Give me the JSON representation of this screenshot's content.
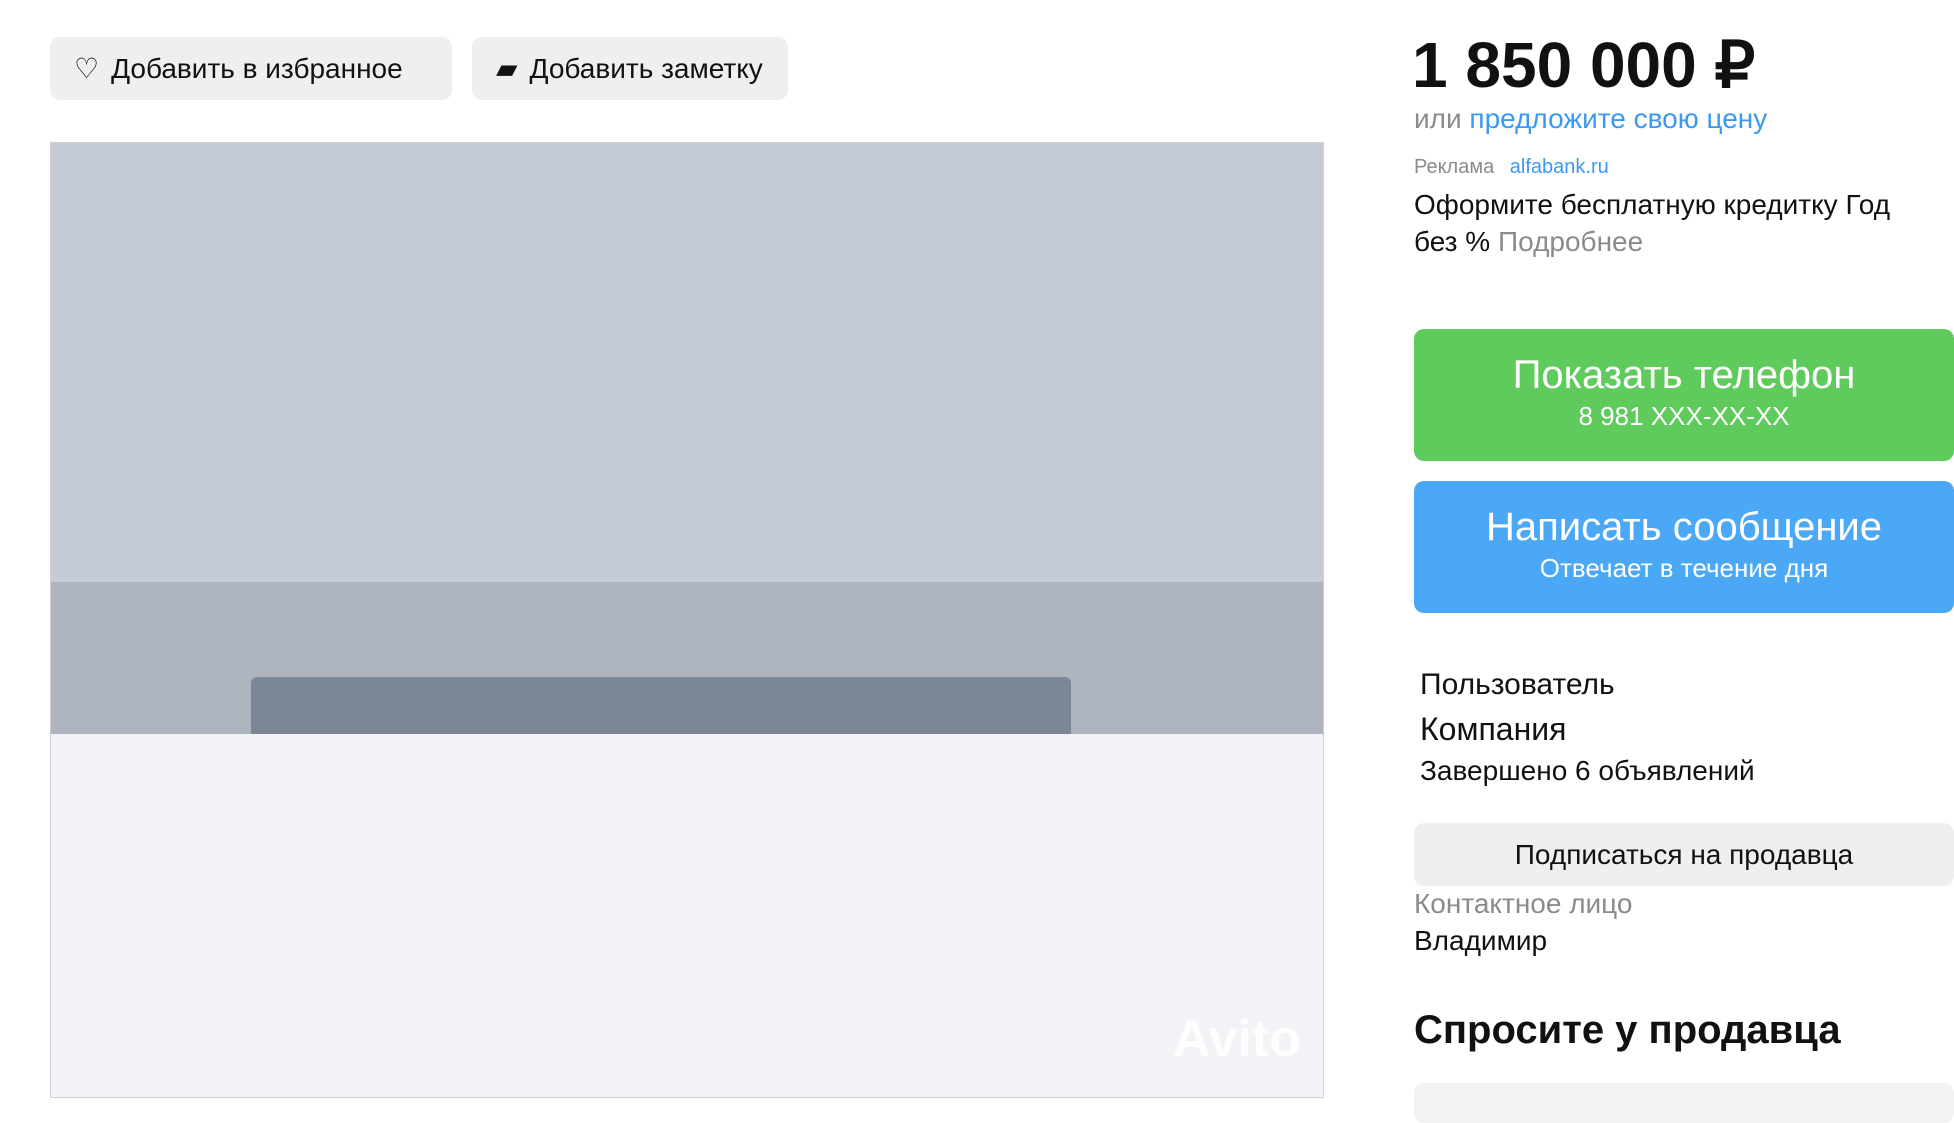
{
  "actions": {
    "favorite": "Добавить в избранное",
    "note": "Добавить заметку"
  },
  "photo": {
    "watermark": "Avito"
  },
  "price": {
    "amount": "1 850 000 ₽",
    "or": "или",
    "offer_link": "предложите свою цену"
  },
  "ad": {
    "label": "Реклама",
    "link": "alfabank.ru",
    "text": "Оформите бесплатную кредитку Год без %",
    "more": "Подробнее"
  },
  "phone": {
    "title": "Показать телефон",
    "number": "8 981 XXX-XX-XX"
  },
  "message": {
    "title": "Написать сообщение",
    "subtitle": "Отвечает в течение дня"
  },
  "seller": {
    "type": "Пользователь",
    "name": "Компания",
    "completed": "Завершено 6 объявлений",
    "subscribe": "Подписаться на продавца",
    "contact_label": "Контактное лицо",
    "contact_name": "Владимир"
  },
  "ask": {
    "title": "Спросите у продавца"
  }
}
